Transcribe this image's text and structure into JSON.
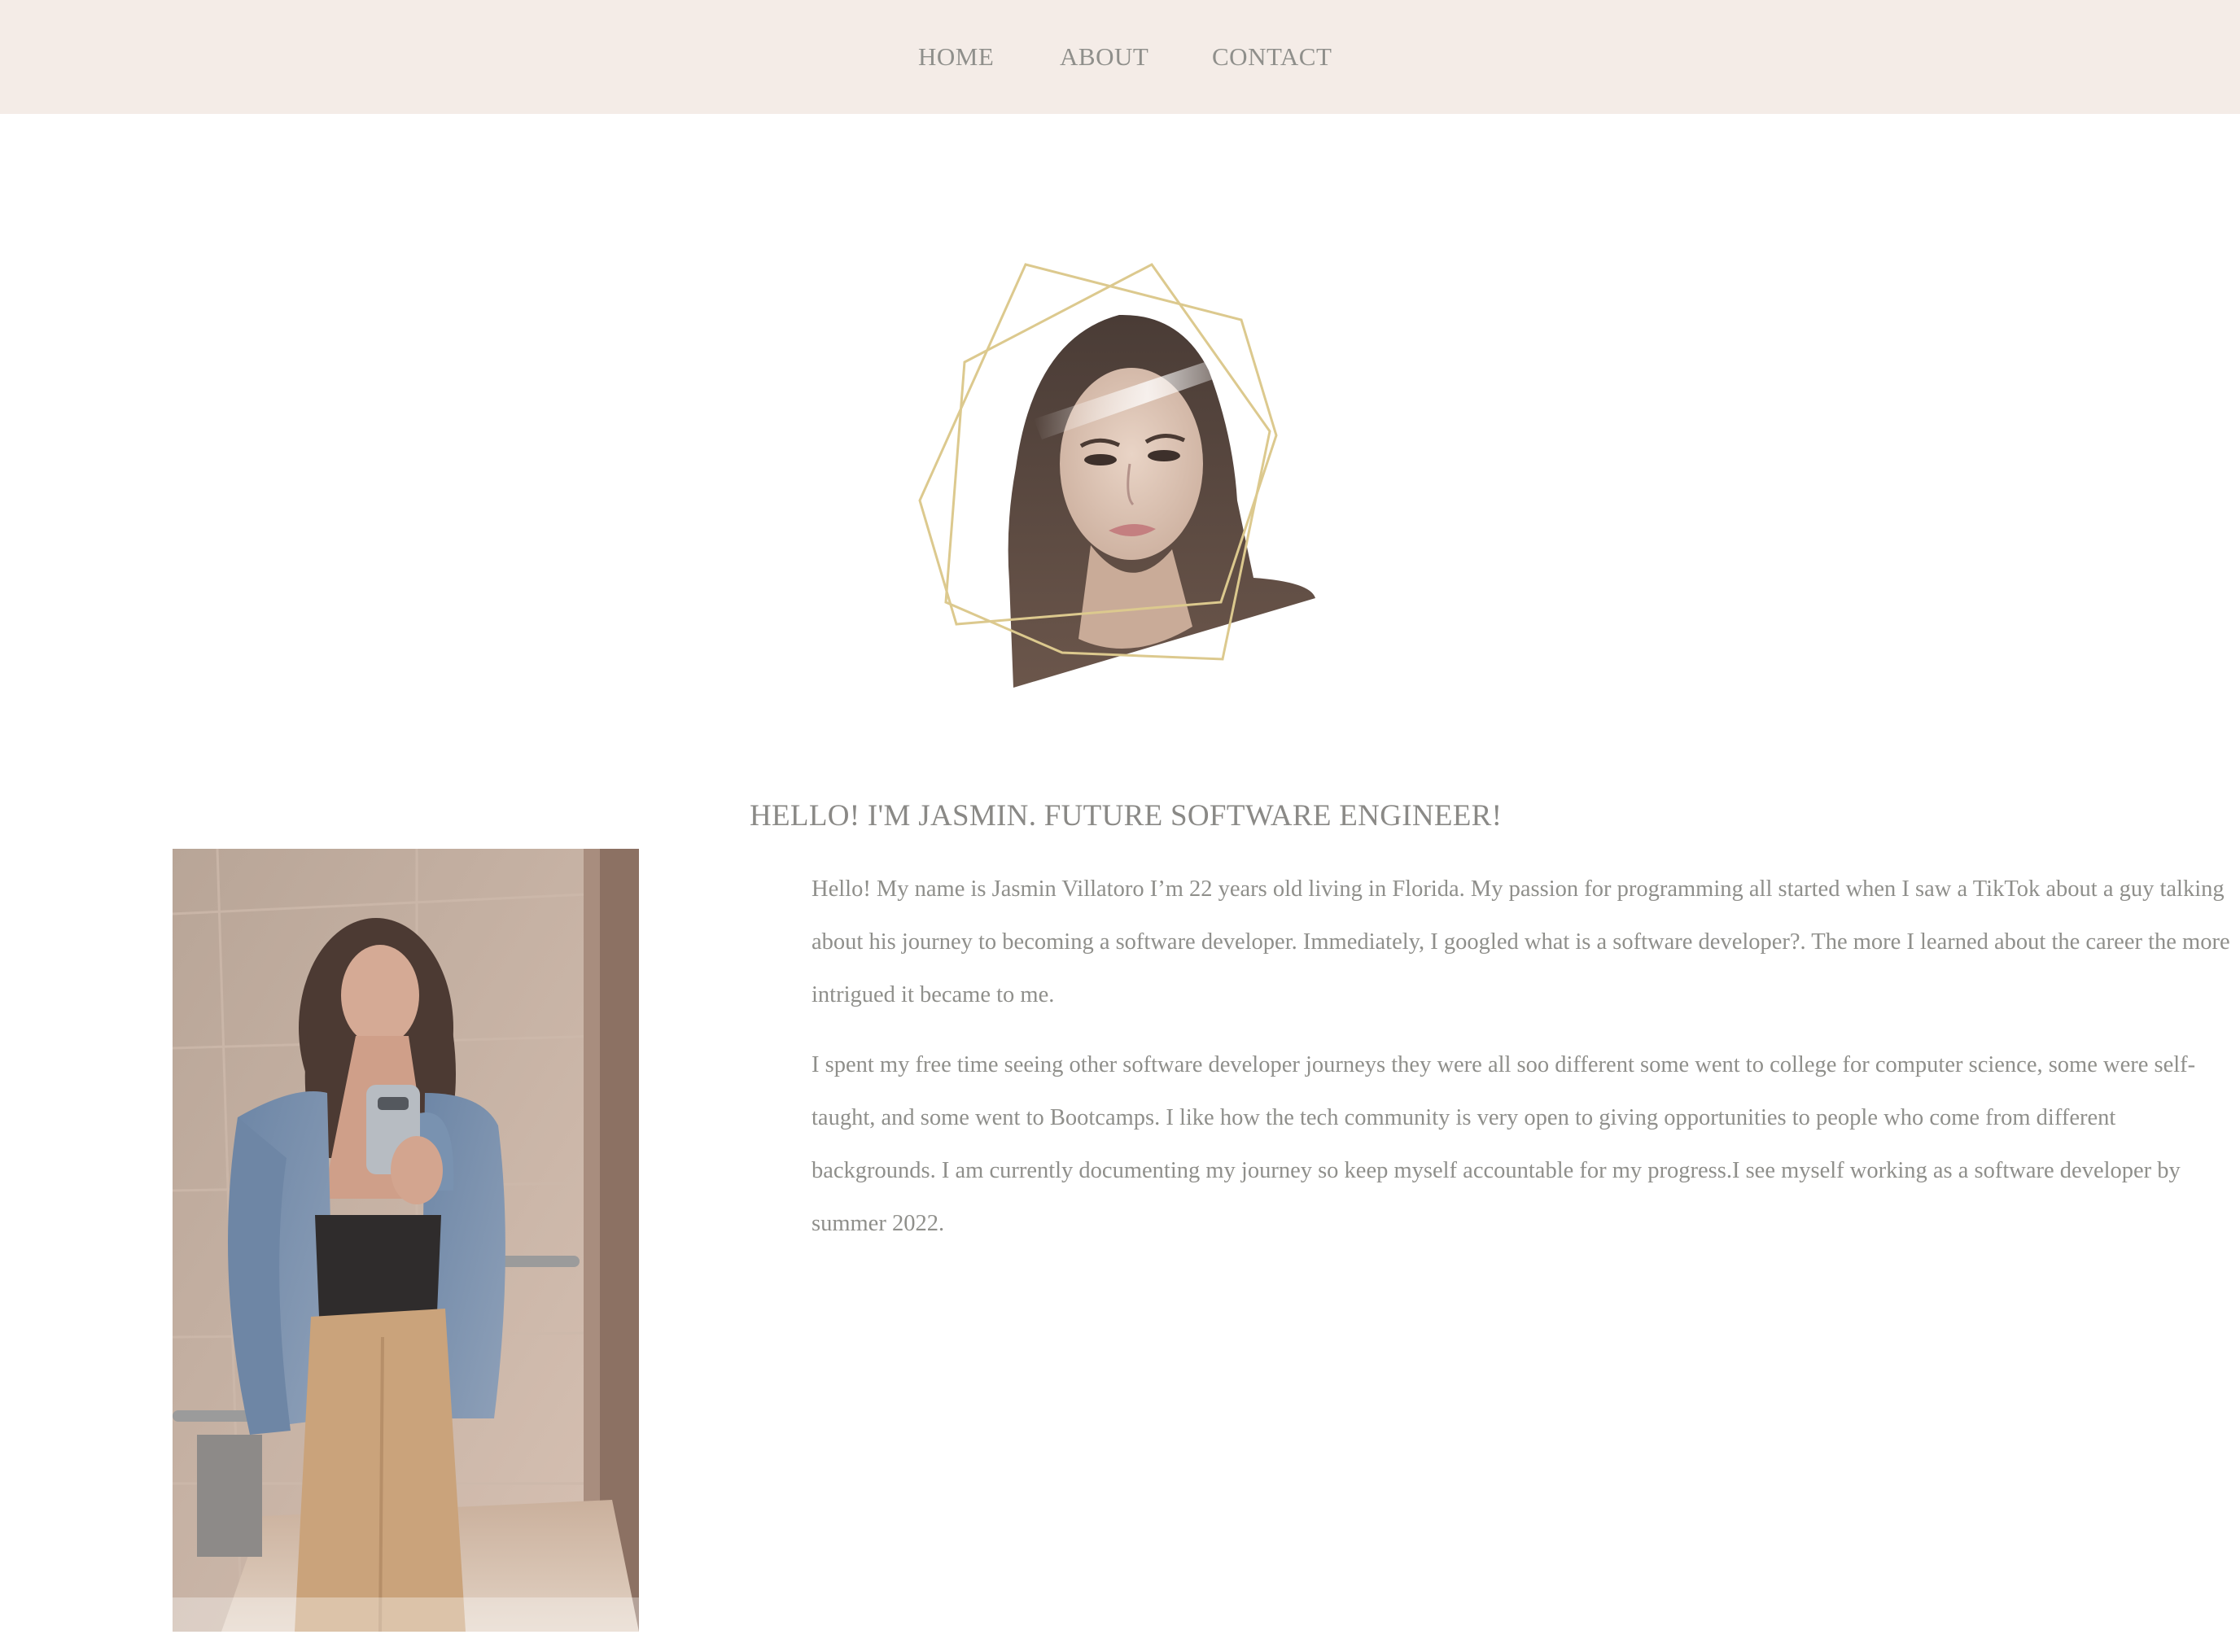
{
  "nav": {
    "items": [
      {
        "label": "HOME"
      },
      {
        "label": "ABOUT"
      },
      {
        "label": "CONTACT"
      }
    ]
  },
  "hero": {
    "heading": "HELLO! I'M JASMIN. FUTURE SOFTWARE ENGINEER!",
    "paragraphs": [
      "Hello! My name is Jasmin Villatoro I’m 22 years old living in Florida. My passion for programming all started when I saw a TikTok about a guy talking about his journey to becoming a software developer. Immediately, I googled what is a software developer?. The more I learned about the career the more intrigued it became to me.",
      "I spent my free time seeing other software developer journeys they were all soo different some went to college for computer science, some were self-taught, and some went to Bootcamps. I like how the tech community is very open to giving opportunities to people who come from different backgrounds. I am currently documenting my journey so keep myself accountable for my progress.I see myself working as a software developer by summer 2022."
    ]
  },
  "colors": {
    "nav_background": "#f4ece7",
    "text": "#8f8f8b",
    "frame_gold": "#dcc98e"
  },
  "icons": {
    "profile_frame": "geometric-gold-frame"
  }
}
